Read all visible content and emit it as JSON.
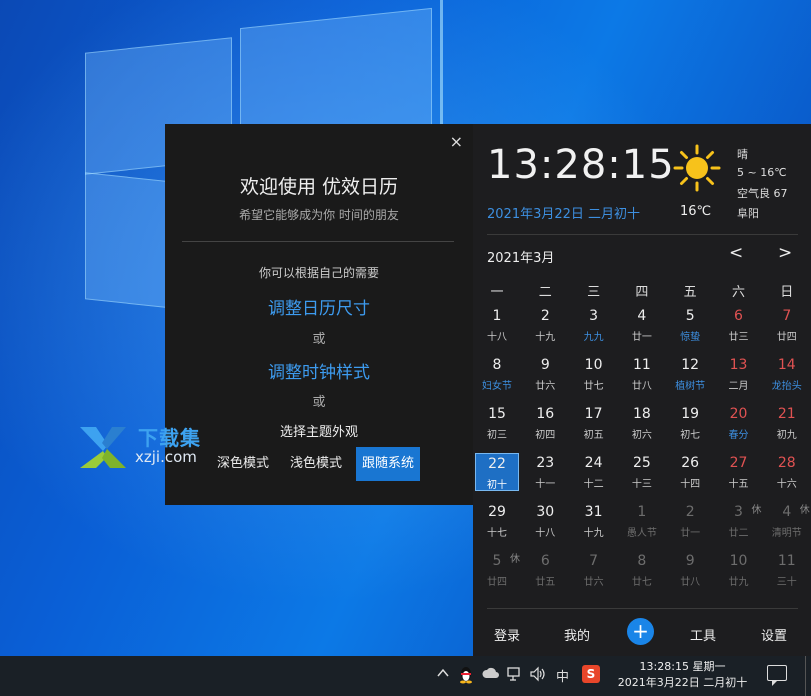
{
  "welcome": {
    "close_label": "×",
    "title": "欢迎使用 优效日历",
    "subtitle": "希望它能够成为你 时间的朋友",
    "need": "你可以根据自己的需要",
    "link_size": "调整日历尺寸",
    "or1": "或",
    "link_style": "调整时钟样式",
    "or2": "或",
    "theme_title": "选择主题外观",
    "themes": [
      "深色模式",
      "浅色模式",
      "跟随系统"
    ],
    "theme_selected": "跟随系统"
  },
  "watermark": {
    "brand": "下载集",
    "domain": "xzji.com"
  },
  "calendar": {
    "time": "13:28:15",
    "date": "2021年3月22日 二月初十",
    "temperature": "16℃",
    "weather": {
      "condition": "晴",
      "range": "5 ~ 16℃",
      "air": "空气良 67",
      "city": "阜阳",
      "icon": "sun-icon"
    },
    "month_title": "2021年3月",
    "nav_prev": "<",
    "nav_next": ">",
    "weekdays": [
      "一",
      "二",
      "三",
      "四",
      "五",
      "六",
      "日"
    ],
    "weeks": [
      [
        {
          "d": "1",
          "l": "十八"
        },
        {
          "d": "2",
          "l": "十九"
        },
        {
          "d": "3",
          "l": "九九",
          "fest": true
        },
        {
          "d": "4",
          "l": "廿一"
        },
        {
          "d": "5",
          "l": "惊蛰",
          "fest": true
        },
        {
          "d": "6",
          "l": "廿三",
          "red": true
        },
        {
          "d": "7",
          "l": "廿四",
          "red": true
        }
      ],
      [
        {
          "d": "8",
          "l": "妇女节",
          "fest": true
        },
        {
          "d": "9",
          "l": "廿六"
        },
        {
          "d": "10",
          "l": "廿七"
        },
        {
          "d": "11",
          "l": "廿八"
        },
        {
          "d": "12",
          "l": "植树节",
          "fest": true
        },
        {
          "d": "13",
          "l": "二月",
          "red": true
        },
        {
          "d": "14",
          "l": "龙抬头",
          "red": true,
          "fest": true
        }
      ],
      [
        {
          "d": "15",
          "l": "初三"
        },
        {
          "d": "16",
          "l": "初四"
        },
        {
          "d": "17",
          "l": "初五"
        },
        {
          "d": "18",
          "l": "初六"
        },
        {
          "d": "19",
          "l": "初七"
        },
        {
          "d": "20",
          "l": "春分",
          "red": true,
          "fest": true
        },
        {
          "d": "21",
          "l": "初九",
          "red": true
        }
      ],
      [
        {
          "d": "22",
          "l": "初十",
          "today": true
        },
        {
          "d": "23",
          "l": "十一"
        },
        {
          "d": "24",
          "l": "十二"
        },
        {
          "d": "25",
          "l": "十三"
        },
        {
          "d": "26",
          "l": "十四"
        },
        {
          "d": "27",
          "l": "十五",
          "red": true
        },
        {
          "d": "28",
          "l": "十六",
          "red": true
        }
      ],
      [
        {
          "d": "29",
          "l": "十七"
        },
        {
          "d": "30",
          "l": "十八"
        },
        {
          "d": "31",
          "l": "十九"
        },
        {
          "d": "1",
          "l": "愚人节",
          "dim": true
        },
        {
          "d": "2",
          "l": "廿一",
          "dim": true
        },
        {
          "d": "3",
          "l": "廿二",
          "dim": true,
          "hol": "休"
        },
        {
          "d": "4",
          "l": "清明节",
          "dim": true,
          "hol": "休"
        }
      ],
      [
        {
          "d": "5",
          "l": "廿四",
          "dim": true,
          "hol": "休"
        },
        {
          "d": "6",
          "l": "廿五",
          "dim": true
        },
        {
          "d": "7",
          "l": "廿六",
          "dim": true
        },
        {
          "d": "8",
          "l": "廿七",
          "dim": true
        },
        {
          "d": "9",
          "l": "廿八",
          "dim": true
        },
        {
          "d": "10",
          "l": "廿九",
          "dim": true
        },
        {
          "d": "11",
          "l": "三十",
          "dim": true
        }
      ]
    ],
    "bottom": {
      "login": "登录",
      "mine": "我的",
      "add": "+",
      "tools": "工具",
      "settings": "设置"
    }
  },
  "taskbar": {
    "time": "13:28:15 星期一",
    "date": "2021年3月22日 二月初十",
    "ime": "中",
    "app_badge": "S"
  }
}
